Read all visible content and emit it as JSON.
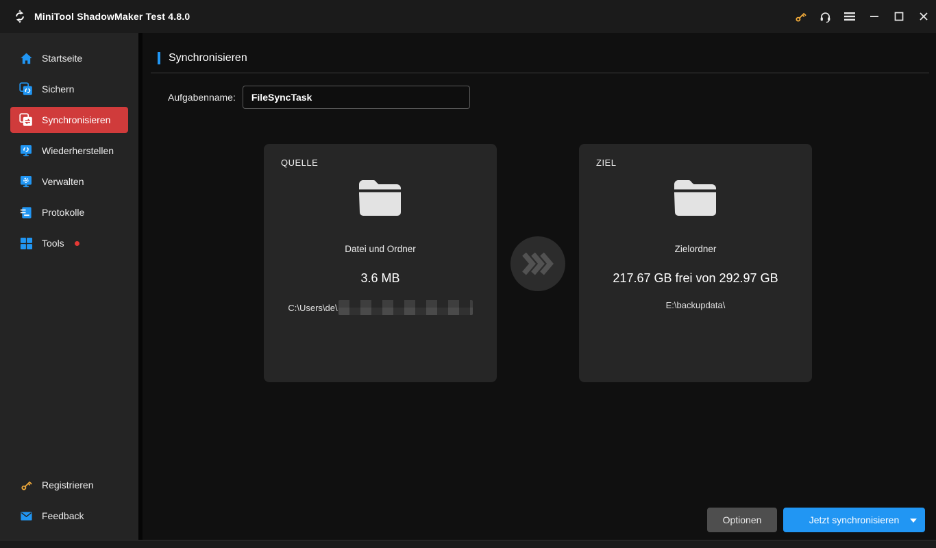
{
  "window": {
    "title": "MiniTool ShadowMaker Test 4.8.0"
  },
  "colors": {
    "accent_red": "#d03b3b",
    "accent_blue": "#2196f3",
    "gold": "#efa93a",
    "titlebar_bg": "#1b1b1b",
    "sidebar_bg": "#242424",
    "main_bg": "#101010",
    "card_bg": "#262626"
  },
  "sidebar": {
    "items": [
      {
        "label": "Startseite",
        "icon": "home-icon",
        "active": false
      },
      {
        "label": "Sichern",
        "icon": "backup-icon",
        "active": false
      },
      {
        "label": "Synchronisieren",
        "icon": "sync-icon",
        "active": true
      },
      {
        "label": "Wiederherstellen",
        "icon": "restore-icon",
        "active": false
      },
      {
        "label": "Verwalten",
        "icon": "manage-icon",
        "active": false
      },
      {
        "label": "Protokolle",
        "icon": "logs-icon",
        "active": false
      },
      {
        "label": "Tools",
        "icon": "tools-grid-icon",
        "active": false,
        "badge_dot": true
      }
    ],
    "footer_items": [
      {
        "label": "Registrieren",
        "icon": "key-icon"
      },
      {
        "label": "Feedback",
        "icon": "mail-icon"
      }
    ]
  },
  "main": {
    "heading": "Synchronisieren",
    "task_name_label": "Aufgabenname:",
    "task_name_value": "FileSyncTask",
    "source_card": {
      "title": "QUELLE",
      "icon": "folder-icon",
      "type_label": "Datei und Ordner",
      "size_label": "3.6 MB",
      "path_prefix": "C:\\Users\\de\\",
      "path_redacted": true
    },
    "target_card": {
      "title": "ZIEL",
      "icon": "folder-icon",
      "type_label": "Zielordner",
      "space_label": "217.67 GB frei von 292.97 GB",
      "path": "E:\\backupdata\\"
    },
    "buttons": {
      "options_label": "Optionen",
      "sync_now_label": "Jetzt synchronisieren"
    }
  }
}
